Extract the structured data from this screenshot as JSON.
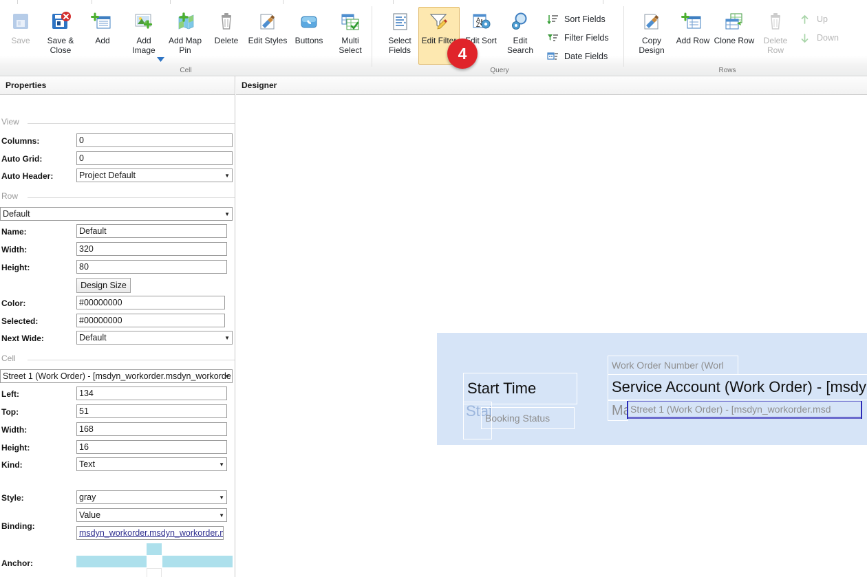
{
  "window": {
    "title": "Designer"
  },
  "ribbon": {
    "groups": [
      {
        "name": "Cell",
        "label": "Cell",
        "buttons": [
          {
            "label": "Save",
            "icon": "save-icon",
            "disabled": true,
            "selected": false
          },
          {
            "label": "Save &\nClose",
            "icon": "save-and-close-icon",
            "disabled": false,
            "selected": false
          },
          {
            "label": "Add",
            "icon": "add-icon",
            "disabled": false,
            "selected": false
          },
          {
            "label": "Add\nImage",
            "icon": "add-image-icon",
            "disabled": false,
            "selected": false
          },
          {
            "label": "Add Map\nPin",
            "icon": "add-map-pin-icon",
            "disabled": false,
            "selected": false
          },
          {
            "label": "Delete",
            "icon": "delete-icon",
            "disabled": false,
            "selected": false
          },
          {
            "label": "Edit Styles",
            "icon": "edit-styles-icon",
            "disabled": false,
            "selected": false
          },
          {
            "label": "Buttons",
            "icon": "buttons-icon",
            "disabled": false,
            "selected": false
          },
          {
            "label": "Multi\nSelect",
            "icon": "multi-select-icon",
            "disabled": false,
            "selected": false
          }
        ]
      },
      {
        "name": "Query",
        "label": "Query",
        "buttons": [
          {
            "label": "Select\nFields",
            "icon": "select-fields-icon",
            "disabled": false,
            "selected": false
          },
          {
            "label": "Edit Filter",
            "icon": "edit-filter-icon",
            "disabled": false,
            "selected": true
          },
          {
            "label": "Edit Sort",
            "icon": "edit-sort-icon",
            "disabled": false,
            "selected": false
          },
          {
            "label": "Edit\nSearch",
            "icon": "edit-search-icon",
            "disabled": false,
            "selected": false
          }
        ],
        "list_buttons": [
          {
            "label": "Sort Fields",
            "icon": "sort-fields-icon"
          },
          {
            "label": "Filter Fields",
            "icon": "filter-fields-icon"
          },
          {
            "label": "Date Fields",
            "icon": "date-fields-icon"
          }
        ]
      },
      {
        "name": "Rows",
        "label": "Rows",
        "buttons": [
          {
            "label": "Copy\nDesign",
            "icon": "copy-design-icon",
            "disabled": false,
            "selected": false
          },
          {
            "label": "Add Row",
            "icon": "add-row-icon",
            "disabled": false,
            "selected": false
          },
          {
            "label": "Clone Row",
            "icon": "clone-row-icon",
            "disabled": false,
            "selected": false
          },
          {
            "label": "Delete\nRow",
            "icon": "delete-row-icon",
            "disabled": true,
            "selected": false
          }
        ],
        "arrow_buttons": [
          {
            "label": "Up",
            "icon": "arrow-up-icon"
          },
          {
            "label": "Down",
            "icon": "arrow-down-icon"
          }
        ]
      }
    ],
    "callout": {
      "number": "4",
      "color": "#e0242a"
    }
  },
  "properties": {
    "title": "Properties",
    "sections": {
      "view": {
        "label": "View",
        "columns_label": "Columns:",
        "columns_value": "0",
        "auto_grid_label": "Auto Grid:",
        "auto_grid_value": "0",
        "auto_header_label": "Auto Header:",
        "auto_header_value": "Project Default"
      },
      "row": {
        "label": "Row",
        "selector_value": "Default",
        "name_label": "Name:",
        "name_value": "Default",
        "width_label": "Width:",
        "width_value": "320",
        "height_label": "Height:",
        "height_value": "80",
        "design_size_label": "Design Size",
        "color_label": "Color:",
        "color_value": "#00000000",
        "selected_label": "Selected:",
        "selected_value": "#00000000",
        "next_wide_label": "Next Wide:",
        "next_wide_value": "Default"
      },
      "cell": {
        "label": "Cell",
        "selector_value": "Street 1 (Work Order) - [msdyn_workorder.msdyn_workorde",
        "left_label": "Left:",
        "left_value": "134",
        "top_label": "Top:",
        "top_value": "51",
        "width_label": "Width:",
        "width_value": "168",
        "height_label": "Height:",
        "height_value": "16",
        "kind_label": "Kind:",
        "kind_value": "Text",
        "style_label": "Style:",
        "style_value": "gray",
        "value_kind_value": "Value",
        "binding_label": "Binding:",
        "binding_value": "msdyn_workorder.msdyn_workorder.ms",
        "anchor_label": "Anchor:",
        "anchor_fill_color": "#ade0ec",
        "anchor_state": {
          "top": true,
          "left": true,
          "right": true,
          "bottom": false,
          "center": false
        }
      }
    }
  },
  "designer": {
    "title": "Designer",
    "canvas": {
      "background": "#d6e4f7"
    },
    "cells": [
      {
        "text": "Start Time",
        "style": "black",
        "size": "large"
      },
      {
        "text": "Status",
        "style": "blue",
        "size": "large"
      },
      {
        "text": "Booking Status",
        "style": "gray",
        "size": "small"
      },
      {
        "text": "Work Order Number (Worl",
        "style": "gray",
        "size": "small"
      },
      {
        "text": "Service Account (Work Order) - [msdyn",
        "style": "black",
        "size": "large"
      },
      {
        "text": "Ma",
        "style": "gray",
        "size": "large"
      },
      {
        "text": "Street 1 (Work Order) - [msdyn_workorder.msd",
        "style": "gray",
        "size": "small",
        "selected": true
      }
    ]
  }
}
